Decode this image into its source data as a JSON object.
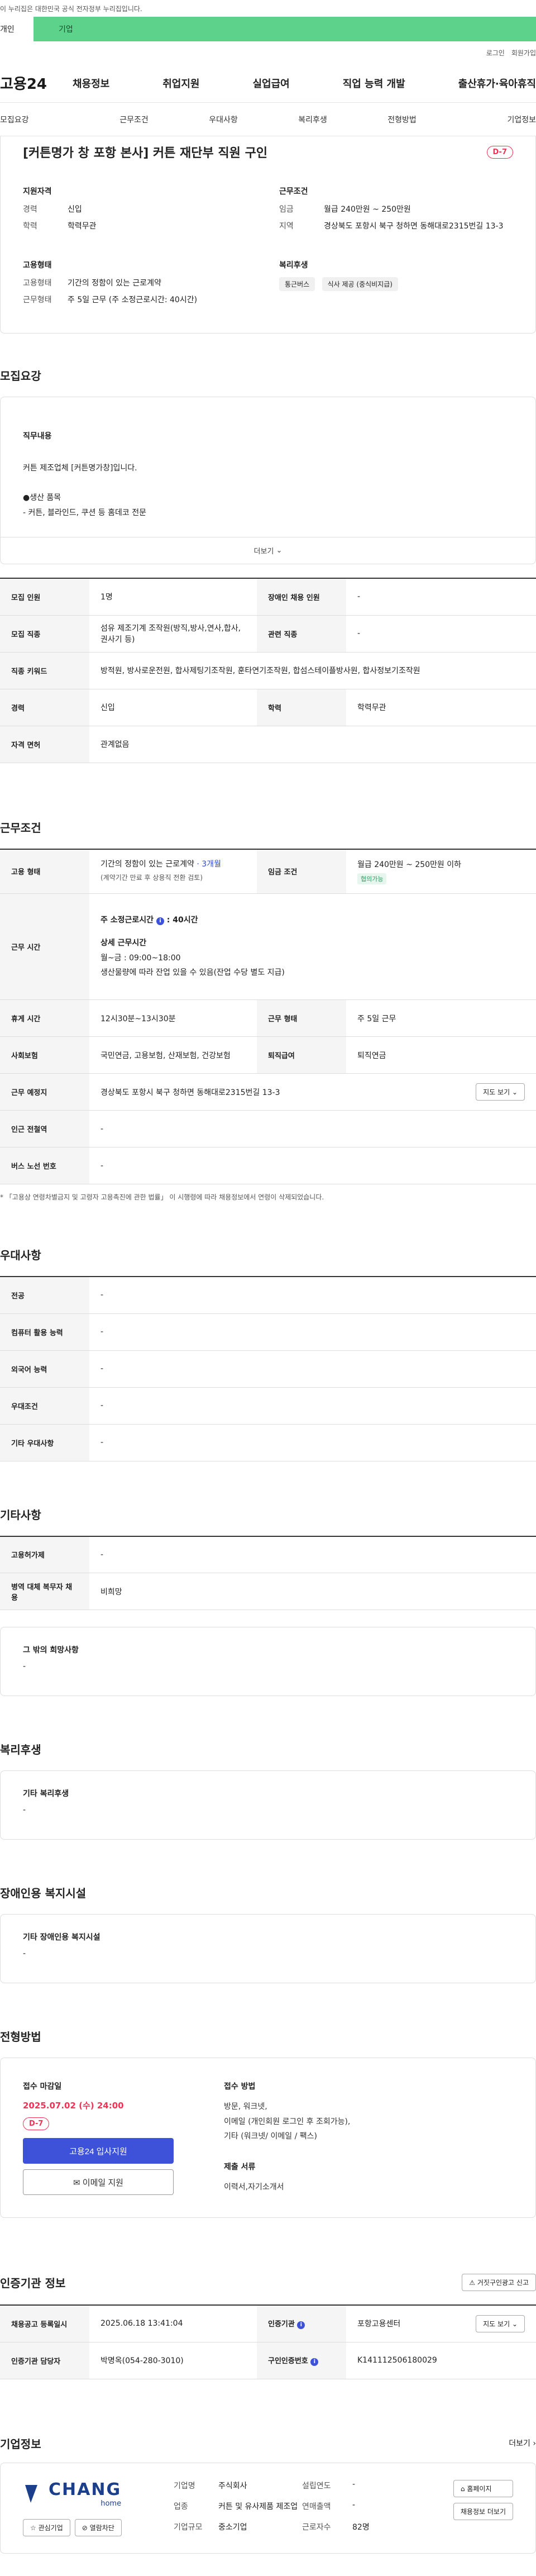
{
  "gov_banner": "이 누리집은 대한민국 공식 전자정부 누리집입니다.",
  "user_tabs": {
    "person": "개인",
    "corp": "기업"
  },
  "util": {
    "login": "로그인",
    "join": "회원가입"
  },
  "logo": "고용24",
  "gnb": [
    "채용정보",
    "취업지원",
    "실업급여",
    "직업 능력 개발",
    "출산휴가·육아휴직"
  ],
  "anchors": [
    "모집요강",
    "근무조건",
    "우대사항",
    "복리후생",
    "전형방법",
    "기업정보"
  ],
  "summary": {
    "title": "[커튼명가 창 포항 본사] 커튼 재단부 직원 구인",
    "dday": "D-7",
    "qualification": {
      "heading": "지원자격",
      "career_k": "경력",
      "career_v": "신입",
      "edu_k": "학력",
      "edu_v": "학력무관"
    },
    "conditions": {
      "heading": "근무조건",
      "wage_k": "임금",
      "wage_v": "월급 240만원 ~ 250만원",
      "area_k": "지역",
      "area_v": "경상북도 포항시 북구 청하면 동해대로2315번길 13-3"
    },
    "employment": {
      "heading": "고용형태",
      "type_k": "고용형태",
      "type_v": "기간의 정함이 있는 근로계약",
      "work_k": "근무형태",
      "work_v": "주 5일 근무 (주 소정근로시간: 40시간)"
    },
    "welfare": {
      "heading": "복리후생",
      "chips": [
        "통근버스",
        "식사 제공 (중식비지급)"
      ]
    }
  },
  "recruit": {
    "title": "모집요강",
    "desc_heading": "직무내용",
    "desc_text": "커튼 제조업체 [커튼명가창]입니다.\n\n●생산 품목\n  - 커튼, 블라인드, 쿠션 등 홈데코 전문\n\n● 담당 업무\n  - 커튼 제작을 위해 원단을 재단하는 업무",
    "more": "더보기",
    "rows": [
      [
        "모집 인원",
        "1명",
        "장애인 채용 인원",
        "-"
      ],
      [
        "모집 직종",
        "섬유 제조기계 조작원(방직,방사,연사,합사, 권사기 등)",
        "관련 직종",
        "-"
      ],
      [
        "직종 키워드",
        "방적원, 방사로운전원, 합사제팅기조작원, 훈타연기조작원, 합섬스테이플방사원, 합사정보기조작원",
        null,
        null
      ],
      [
        "경력",
        "신입",
        "학력",
        "학력무관"
      ],
      [
        "자격 면허",
        "관계없음",
        null,
        null
      ]
    ]
  },
  "work": {
    "title": "근무조건",
    "emp_k": "고용 형태",
    "emp_v": "기간의 정함이 있는 근로계약",
    "emp_period": "· 3개월",
    "emp_note": "(계약기간 만료 후 상용직 전환 검토)",
    "wage_k": "임금 조건",
    "wage_v": "월급 240만원 ~ 250만원 이하",
    "wage_badge": "협의가능",
    "hours_k": "근무 시간",
    "hours_title": "주 소정근로시간",
    "hours_value": ": 40시간",
    "hours_detail_title": "상세 근무시간",
    "hours_detail": "월~금 : 09:00~18:00",
    "hours_extra": "생산물량에 따라 잔업 있을 수 있음(잔업 수당 별도 지급)",
    "rows": [
      [
        "휴게 시간",
        "12시30분~13시30분",
        "근무 형태",
        "주 5일 근무"
      ],
      [
        "사회보험",
        "국민연금, 고용보험, 산재보험, 건강보험",
        "퇴직급여",
        "퇴직연금"
      ]
    ],
    "place_k": "근무 예정지",
    "place_v": "경상북도 포항시 북구 청하면 동해대로2315번길 13-3",
    "map_btn": "지도 보기",
    "station_k": "인근 전철역",
    "station_v": "-",
    "bus_k": "버스 노선 번호",
    "bus_v": "-",
    "note": "* 「고용상 연령차별금지 및 고령자 고용촉진에 관한 법률」 이 시행령에 따라 채용정보에서 연령이 삭제되었습니다."
  },
  "preference": {
    "title": "우대사항",
    "rows": [
      [
        "전공",
        "-"
      ],
      [
        "컴퓨터 활용 능력",
        "-"
      ],
      [
        "외국어 능력",
        "-"
      ],
      [
        "우대조건",
        "-"
      ],
      [
        "기타 우대사항",
        "-"
      ]
    ]
  },
  "etc": {
    "title": "기타사항",
    "rows": [
      [
        "고용허가제",
        "-"
      ],
      [
        "병역 대체 복무자 채용",
        "비희망"
      ]
    ],
    "other_heading": "그 밖의 희망사항",
    "other_value": "-"
  },
  "benefit": {
    "title": "복리후생",
    "heading": "기타 복리후생",
    "value": "-"
  },
  "disabled": {
    "title": "장애인용 복지시설",
    "heading": "기타 장애인용 복지시설",
    "value": "-"
  },
  "process": {
    "title": "전형방법",
    "deadline_label": "접수 마감일",
    "deadline": "2025.07.02 (수) 24:00",
    "dday": "D-7",
    "apply_btn": "고용24 입사지원",
    "email_btn": "이메일 지원",
    "method_label": "접수 방법",
    "method_text": "방문, 워크넷,\n이메일 (개인회원 로그인 후 조회가능),\n기타 (워크넷/ 이메일 / 팩스)",
    "docs_label": "제출 서류",
    "docs_text": "이력서,자기소개서"
  },
  "cert": {
    "title": "인증기관 정보",
    "report_btn": "거짓구인광고 신고",
    "rows": [
      [
        "채용공고 등록일시",
        "2025.06.18 13:41:04",
        "인증기관",
        "포항고용센터"
      ],
      [
        "인증기관 담당자",
        "박명옥(054-280-3010)",
        "구인인증번호",
        "K141112506180029"
      ]
    ],
    "map_btn": "지도 보기"
  },
  "company": {
    "title": "기업정보",
    "more": "더보기",
    "logo_text": "CHANG",
    "logo_sub": "home",
    "fav_btn": "관심기업",
    "block_btn": "열람차단",
    "name_k": "기업명",
    "name_v": "주식회사",
    "biz_k": "업종",
    "biz_v": "커튼 및 유사제품 제조업",
    "size_k": "기업규모",
    "size_v": "중소기업",
    "year_k": "설립연도",
    "year_v": "-",
    "sales_k": "연매출액",
    "sales_v": "-",
    "emp_k": "근로자수",
    "emp_v": "82명",
    "home_btn": "홈페이지",
    "jobs_btn": "채용정보 더보기"
  }
}
